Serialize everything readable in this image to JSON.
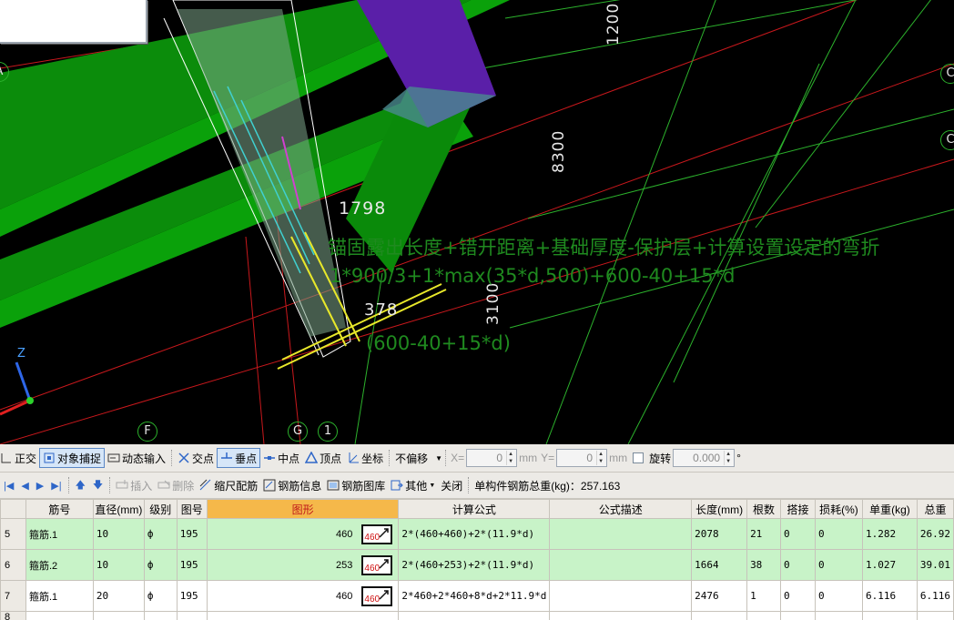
{
  "viewport": {
    "dimensions": [
      "1200",
      "8300",
      "3100"
    ],
    "dim_labels": [
      "1798",
      "378"
    ],
    "formula_lines": [
      "锚固露出长度+错开距离+基础厚度-保护层+计算设置设定的弯折",
      "1*900/3+1*max(35*d,500)+600-40+15*d",
      "(600-40+15*d)"
    ],
    "axis_labels": [
      "A",
      "F",
      "G",
      "1",
      "C",
      "C"
    ],
    "axis_z": "Z",
    "colors": {
      "beam_green": "#0aa10a",
      "column_purple": "#5a1fa8",
      "grid_line": "#2cb22c",
      "axis_red": "#c8181c"
    }
  },
  "snap_toolbar": {
    "items": [
      "正交",
      "对象捕捉",
      "动态输入",
      "交点",
      "垂点",
      "中点",
      "顶点",
      "坐标",
      "不偏移"
    ],
    "x_label": "X=",
    "x_value": "0",
    "x_unit": "mm",
    "y_label": "Y=",
    "y_value": "0",
    "y_unit": "mm",
    "rotate_label": "旋转",
    "rotate_value": "0.000",
    "degree": "°"
  },
  "edit_toolbar": {
    "insert": "插入",
    "delete": "删除",
    "scale_rebar": "缩尺配筋",
    "rebar_info": "钢筋信息",
    "rebar_library": "钢筋图库",
    "other": "其他",
    "close": "关闭",
    "total_weight": "单构件钢筋总重(kg)：257.163"
  },
  "table": {
    "headers": [
      "",
      "筋号",
      "直径(mm)",
      "级别",
      "图号",
      "图形",
      "计算公式",
      "公式描述",
      "长度(mm)",
      "根数",
      "搭接",
      "损耗(%)",
      "单重(kg)",
      "总重"
    ],
    "rows": [
      {
        "num": "5",
        "name": "箍筋.1",
        "diameter": "10",
        "grade": "ф",
        "fig_no": "195",
        "shape_num": "460",
        "shape_label": "460",
        "formula": "2*(460+460)+2*(11.9*d)",
        "desc": "",
        "length": "2078",
        "count": "21",
        "lap": "0",
        "loss": "0",
        "unit_weight": "1.282",
        "total_weight": "26.92"
      },
      {
        "num": "6",
        "name": "箍筋.2",
        "diameter": "10",
        "grade": "ф",
        "fig_no": "195",
        "shape_num": "253",
        "shape_label": "460",
        "formula": "2*(460+253)+2*(11.9*d)",
        "desc": "",
        "length": "1664",
        "count": "38",
        "lap": "0",
        "loss": "0",
        "unit_weight": "1.027",
        "total_weight": "39.01"
      },
      {
        "num": "7",
        "name": "箍筋.1",
        "diameter": "20",
        "grade": "ф",
        "fig_no": "195",
        "shape_num": "460",
        "shape_label": "460",
        "formula": "2*460+2*460+8*d+2*11.9*d",
        "desc": "",
        "length": "2476",
        "count": "1",
        "lap": "0",
        "loss": "0",
        "unit_weight": "6.116",
        "total_weight": "6.116"
      }
    ],
    "next_row_num": "8"
  }
}
